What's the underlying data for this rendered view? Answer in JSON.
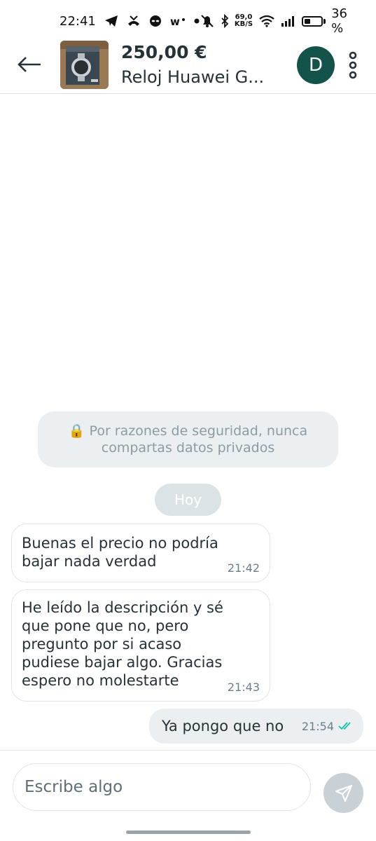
{
  "status_bar": {
    "time": "22:41",
    "speed_value": "69,0",
    "speed_unit": "KB/S",
    "signal_label": "5",
    "battery_percent": "36 %",
    "battery_level": 0.36,
    "icons": [
      "telegram-icon",
      "missed-call-icon",
      "alien-icon",
      "wallapop-icon",
      "dot-icon",
      "mute-icon",
      "bluetooth-icon",
      "wifi-icon",
      "cell-signal-icon",
      "battery-icon"
    ]
  },
  "header": {
    "price": "250,00 €",
    "title": "Reloj Huawei G...",
    "avatar_letter": "D",
    "avatar_color": "#13534a"
  },
  "chat": {
    "security_notice": "🔒 Por razones de seguridad, nunca compartas datos privados",
    "day_label": "Hoy",
    "messages": [
      {
        "text": "Buenas el precio no podría bajar nada verdad",
        "time": "21:42",
        "direction": "incoming"
      },
      {
        "text": "He leído la descripción y sé que pone que no, pero pregunto por si acaso pudiese bajar algo. Gracias espero no molestarte",
        "time": "21:43",
        "direction": "incoming"
      },
      {
        "text": "Ya pongo que no",
        "time": "21:54",
        "direction": "outgoing",
        "status": "read"
      }
    ]
  },
  "composer": {
    "placeholder": "Escribe algo",
    "value": ""
  },
  "colors": {
    "accent": "#13534a",
    "read_tick": "#13c1ac",
    "bubble_bg": "#ebeff1"
  }
}
